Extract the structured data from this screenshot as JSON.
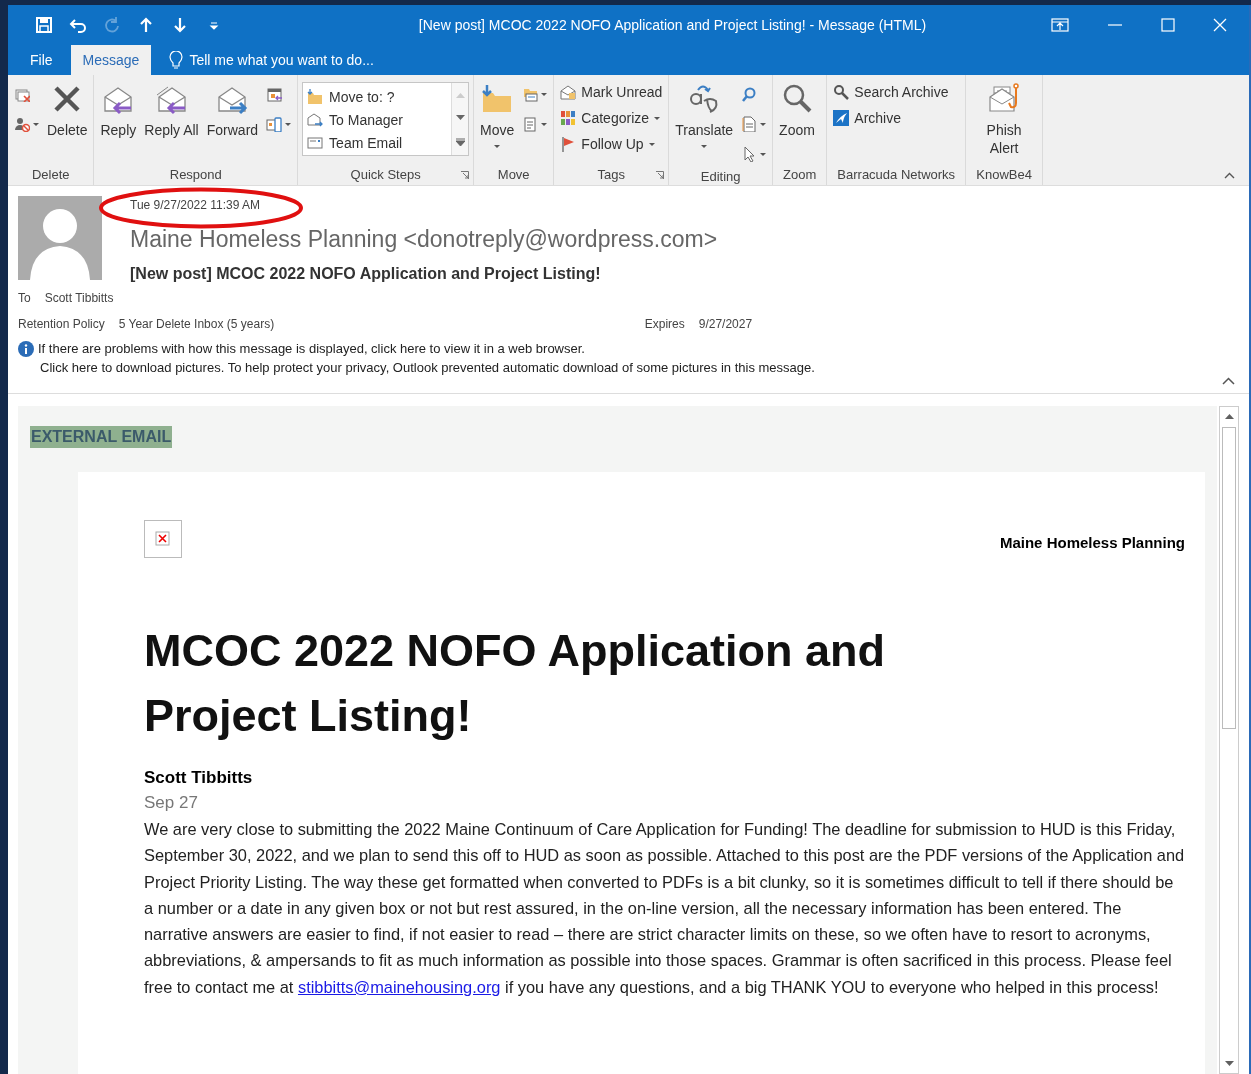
{
  "window": {
    "title": "[New post] MCOC 2022 NOFO Application and Project Listing! - Message (HTML)"
  },
  "quick_access": [
    {
      "disabled": false
    },
    {
      "disabled": false
    },
    {
      "disabled": true
    },
    {
      "disabled": false
    },
    {
      "disabled": false
    },
    {
      "disabled": false
    }
  ],
  "tabs": [
    {
      "label": "File",
      "selected": false
    },
    {
      "label": "Message",
      "selected": true
    }
  ],
  "tell_me": "Tell me what you want to do...",
  "ribbon": {
    "groups": [
      {
        "label": "Delete",
        "launcher": false,
        "columns": [
          [
            {
              "kind": "icon",
              "dropdown": false
            },
            {
              "kind": "icon",
              "dropdown": true
            }
          ],
          [
            {
              "kind": "large",
              "label": "Delete",
              "dropdown": false
            }
          ]
        ]
      },
      {
        "label": "Respond",
        "launcher": false,
        "columns": [
          [
            {
              "kind": "large",
              "label": "Reply",
              "dropdown": false
            }
          ],
          [
            {
              "kind": "large",
              "label": "Reply All",
              "dropdown": false
            }
          ],
          [
            {
              "kind": "large",
              "label": "Forward",
              "dropdown": false
            }
          ],
          [
            {
              "kind": "icon",
              "dropdown": false
            },
            {
              "kind": "icon",
              "dropdown": true
            }
          ]
        ]
      },
      {
        "label": "Quick Steps",
        "launcher": true,
        "gallery": [
          "Move to: ?",
          "To Manager",
          "Team Email"
        ]
      },
      {
        "label": "Move",
        "launcher": false,
        "columns": [
          [
            {
              "kind": "large",
              "label": "Move",
              "dropdown": true
            }
          ],
          [
            {
              "kind": "icon",
              "dropdown": true
            },
            {
              "kind": "icon",
              "dropdown": true
            }
          ]
        ]
      },
      {
        "label": "Tags",
        "launcher": true,
        "columns": [
          [
            {
              "kind": "small",
              "label": "Mark Unread",
              "dropdown": false
            },
            {
              "kind": "small",
              "label": "Categorize",
              "dropdown": true
            },
            {
              "kind": "small",
              "label": "Follow Up",
              "dropdown": true
            }
          ]
        ]
      },
      {
        "label": "Editing",
        "launcher": false,
        "columns": [
          [
            {
              "kind": "large",
              "label": "Translate",
              "dropdown": true
            }
          ],
          [
            {
              "kind": "icon",
              "dropdown": false
            },
            {
              "kind": "icon",
              "dropdown": true
            },
            {
              "kind": "icon",
              "dropdown": true
            }
          ]
        ]
      },
      {
        "label": "Zoom",
        "launcher": false,
        "columns": [
          [
            {
              "kind": "large",
              "label": "Zoom",
              "dropdown": false
            }
          ]
        ]
      },
      {
        "label": "Barracuda Networks",
        "launcher": false,
        "columns": [
          [
            {
              "kind": "small",
              "label": "Search Archive",
              "dropdown": false
            },
            {
              "kind": "small",
              "label": "Archive",
              "dropdown": false
            }
          ]
        ]
      },
      {
        "label": "KnowBe4",
        "launcher": false,
        "columns": [
          [
            {
              "kind": "large",
              "label": "Phish Alert",
              "dropdown": false
            }
          ]
        ]
      }
    ]
  },
  "header": {
    "date": "Tue 9/27/2022 11:39 AM",
    "sender": "Maine Homeless Planning <donotreply@wordpress.com>",
    "subject": "[New post] MCOC 2022 NOFO Application and Project Listing!",
    "to_label": "To",
    "to": "Scott Tibbitts",
    "retention_label": "Retention Policy",
    "retention": "5 Year Delete Inbox (5 years)",
    "expires_label": "Expires",
    "expires": "9/27/2027",
    "info": [
      "If there are problems with how this message is displayed, click here to view it in a web browser.",
      "Click here to download pictures. To help protect your privacy, Outlook prevented automatic download of some pictures in this message."
    ]
  },
  "body": {
    "banner": "EXTERNAL EMAIL",
    "site_name": "Maine Homeless Planning",
    "heading": "MCOC 2022 NOFO Application and Project Listing!",
    "author": "Scott Tibbitts",
    "post_date": "Sep 27",
    "paragraph": {
      "before": "We are very close to submitting the 2022 Maine Continuum of Care Application for Funding! The deadline for submission to HUD is this Friday, September 30, 2022, and we plan to send this off to HUD as soon as possible. Attached to this post are the PDF versions of the Application and Project Priority Listing. The way these get formatted when converted to PDFs is a bit clunky, so it is sometimes difficult to tell if there should be a number or a date in any given box or not but rest assured, in the on-line version, all the necessary information has been entered. The narrative answers are easier to find, if not easier to read – there are strict character limits on these, so we often have to resort to acronyms, abbreviations, & ampersands to fit as much information as possible into those spaces. Grammar is often sacrificed in this process. Please feel free to contact me at",
      "link": "stibbitts@mainehousing.org",
      "after": "if you have any questions, and a big THANK YOU to everyone who helped in this process!"
    }
  }
}
